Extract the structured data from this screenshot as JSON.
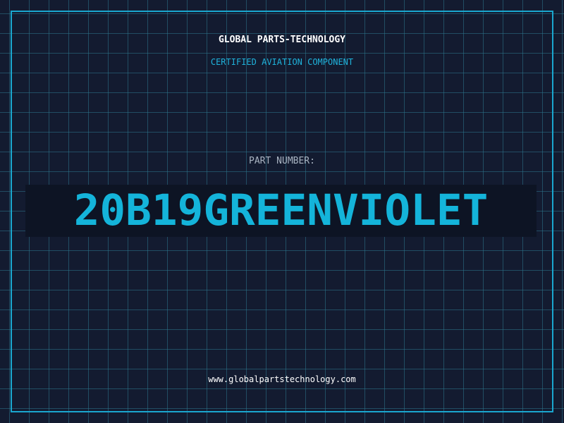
{
  "header": {
    "company": "GLOBAL PARTS-TECHNOLOGY",
    "tagline": "CERTIFIED AVIATION COMPONENT"
  },
  "part": {
    "label": "PART NUMBER:",
    "number": "20B19GREENVIOLET"
  },
  "footer": {
    "website": "www.globalpartstechnology.com"
  },
  "colors": {
    "background": "#131b30",
    "accent": "#1aa7cf",
    "part_number": "#14b4da",
    "text": "#ffffff",
    "label": "#a9b4c2"
  }
}
